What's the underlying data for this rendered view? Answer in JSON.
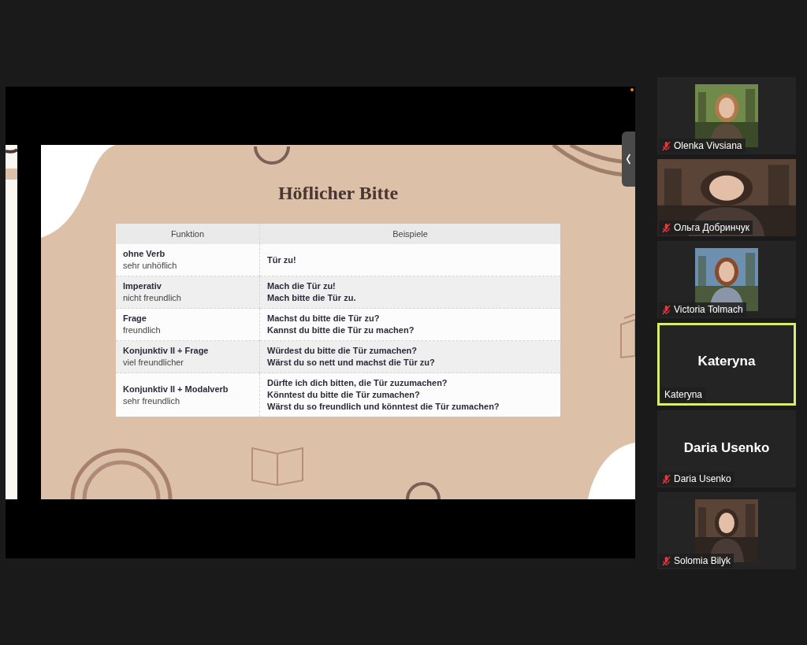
{
  "share": {
    "slide": {
      "title": "Höflicher Bitte",
      "table": {
        "columns": [
          "Funktion",
          "Beispiele"
        ],
        "rows": [
          {
            "function": "ohne Verb",
            "note": "sehr unhöflich",
            "examples": [
              "Tür zu!"
            ]
          },
          {
            "function": "Imperativ",
            "note": "nicht freundlich",
            "examples": [
              "Mach die Tür zu!",
              "Mach bitte die Tür zu."
            ]
          },
          {
            "function": "Frage",
            "note": "freundlich",
            "examples": [
              "Machst du bitte die Tür zu?",
              "Kannst du bitte die Tür zu machen?"
            ]
          },
          {
            "function": "Konjunktiv II + Frage",
            "note": "viel freundlicher",
            "examples": [
              "Würdest du bitte die Tür zumachen?",
              "Wärst du so nett und machst die Tür zu?"
            ]
          },
          {
            "function": "Konjunktiv II + Modalverb",
            "note": "sehr freundlich",
            "examples": [
              "Dürfte ich dich bitten, die Tür zuzumachen?",
              "Könntest du bitte die Tür zumachen?",
              "Wärst du so freundlich und könntest die Tür zumachen?"
            ]
          }
        ]
      }
    }
  },
  "participants": [
    {
      "name": "Olenka Vivsiana",
      "muted": true,
      "speaking": false
    },
    {
      "name": "Ольга Добринчук",
      "kind": "video",
      "muted": true,
      "speaking": false
    },
    {
      "name": "Victoria Tolmach",
      "muted": true,
      "speaking": false
    },
    {
      "name": "Kateryna",
      "kind": "name",
      "display_name": "Kateryna",
      "muted": false,
      "speaking": true
    },
    {
      "name": "Daria Usenko",
      "kind": "name",
      "display_name": "Daria Usenko",
      "muted": true,
      "speaking": false
    },
    {
      "name": "Solomia Bilyk",
      "muted": true,
      "speaking": false
    }
  ]
}
